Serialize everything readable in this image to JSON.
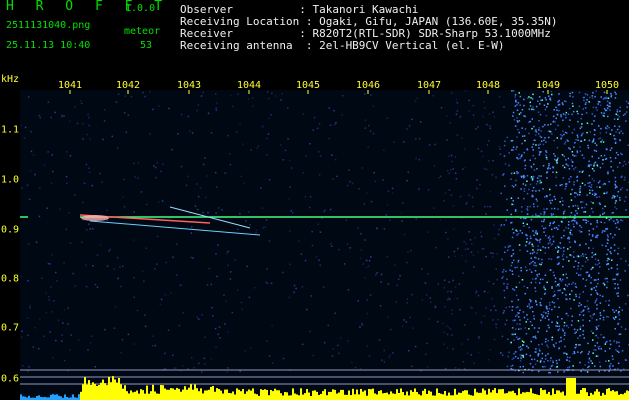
{
  "header": {
    "app_title": "H R O F F T",
    "app_version": "1.0.0",
    "file_name": "2511131040.png",
    "detect_label": "meteor",
    "detect_count": "53",
    "timestamp": "25.11.13 10:40",
    "meta": [
      "Observer          : Takanori Kawachi",
      "Receiving Location : Ogaki, Gifu, JAPAN (136.60E, 35.35N)",
      "Receiver          : R820T2(RTL-SDR) SDR-Sharp 53.1000MHz",
      "Receiving antenna  : 2el-HB9CV Vertical (el. E-W)"
    ]
  },
  "axis": {
    "unit": "kHz",
    "freq_ticks": [
      "1041",
      "1042",
      "1043",
      "1044",
      "1045",
      "1046",
      "1047",
      "1048",
      "1049",
      "1050"
    ],
    "time_ticks": [
      "1.1",
      "1.0",
      "0.9",
      "0.8",
      "0.7",
      "0.6"
    ]
  },
  "colors": {
    "background": "#000000",
    "header_green": "#00e000",
    "tick_yellow": "#ffff33",
    "noise_blue": "#1a3cff",
    "echo_line": "#40ff80",
    "power_bar": "#ffff00"
  }
}
